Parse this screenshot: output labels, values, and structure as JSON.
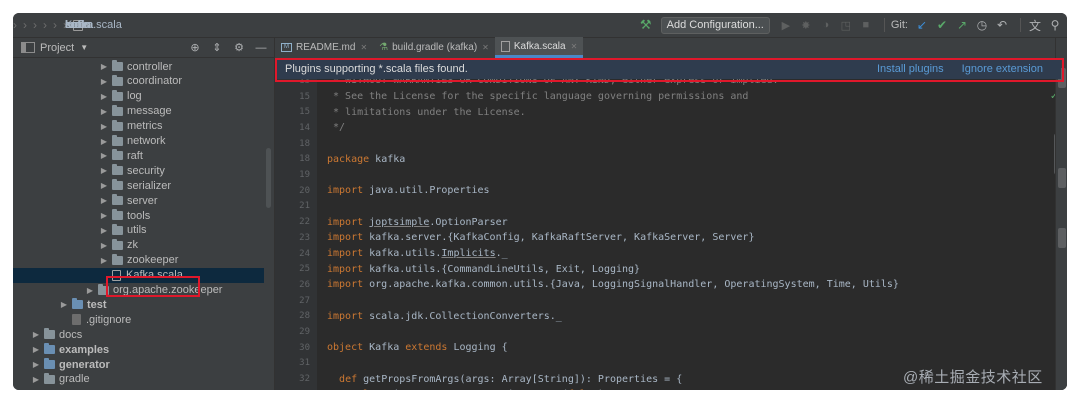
{
  "navbar": {
    "crumbs": [
      "kafka",
      "core",
      "src",
      "main",
      "scala",
      "kafka",
      "Kafka.scala"
    ],
    "add_configuration": "Add Configuration...",
    "git_label": "Git:"
  },
  "project_panel": {
    "title": "Project",
    "tree": [
      {
        "label": "controller",
        "type": "folder",
        "depth": 4
      },
      {
        "label": "coordinator",
        "type": "folder",
        "depth": 4
      },
      {
        "label": "log",
        "type": "folder",
        "depth": 4
      },
      {
        "label": "message",
        "type": "folder",
        "depth": 4
      },
      {
        "label": "metrics",
        "type": "folder",
        "depth": 4
      },
      {
        "label": "network",
        "type": "folder",
        "depth": 4
      },
      {
        "label": "raft",
        "type": "folder",
        "depth": 4
      },
      {
        "label": "security",
        "type": "folder",
        "depth": 4
      },
      {
        "label": "serializer",
        "type": "folder",
        "depth": 4
      },
      {
        "label": "server",
        "type": "folder",
        "depth": 4
      },
      {
        "label": "tools",
        "type": "folder",
        "depth": 4
      },
      {
        "label": "utils",
        "type": "folder",
        "depth": 4
      },
      {
        "label": "zk",
        "type": "folder",
        "depth": 4
      },
      {
        "label": "zookeeper",
        "type": "folder",
        "depth": 4
      },
      {
        "label": "Kafka.scala",
        "type": "scala",
        "depth": 4,
        "selected": true
      },
      {
        "label": "org.apache.zookeeper",
        "type": "folder",
        "depth": 3
      },
      {
        "label": "test",
        "type": "folder-blue",
        "depth": 2,
        "bold": true
      },
      {
        "label": ".gitignore",
        "type": "git",
        "depth": 2
      },
      {
        "label": "docs",
        "type": "folder",
        "depth": 1
      },
      {
        "label": "examples",
        "type": "folder-blue",
        "depth": 1,
        "bold": true
      },
      {
        "label": "generator",
        "type": "folder-blue",
        "depth": 1,
        "bold": true
      },
      {
        "label": "gradle",
        "type": "folder",
        "depth": 1
      }
    ]
  },
  "editor": {
    "tabs": [
      {
        "label": "README.md",
        "icon": "markdown-icon",
        "active": false
      },
      {
        "label": "build.gradle (kafka)",
        "icon": "gradle-icon",
        "active": false
      },
      {
        "label": "Kafka.scala",
        "icon": "scala-file-icon",
        "active": true
      }
    ],
    "banner": {
      "message": "Plugins supporting *.scala files found.",
      "install": "Install plugins",
      "ignore": "Ignore extension"
    },
    "lines": [
      {
        "n": "13",
        "t": " * WITHOUT WARRANTIES OR CONDITIONS OF ANY KIND, either express or implied.",
        "c": "comment"
      },
      {
        "n": "15",
        "t": " * See the License for the specific language governing permissions and",
        "c": "comment"
      },
      {
        "n": "15",
        "t": " * limitations under the License.",
        "c": "comment"
      },
      {
        "n": "14",
        "t": " */",
        "c": "comment"
      },
      {
        "n": "18",
        "t": "",
        "c": "plain"
      },
      {
        "n": "18",
        "t": "package kafka",
        "c": "plain"
      },
      {
        "n": "19",
        "t": "",
        "c": "plain"
      },
      {
        "n": "20",
        "t": "import java.util.Properties",
        "c": "plain"
      },
      {
        "n": "21",
        "t": "",
        "c": "plain"
      },
      {
        "n": "22",
        "t": "import joptsimple.OptionParser",
        "c": "plain"
      },
      {
        "n": "23",
        "t": "import kafka.server.{KafkaConfig, KafkaRaftServer, KafkaServer, Server}",
        "c": "plain"
      },
      {
        "n": "24",
        "t": "import kafka.utils.Implicits._",
        "c": "plain"
      },
      {
        "n": "25",
        "t": "import kafka.utils.{CommandLineUtils, Exit, Logging}",
        "c": "plain"
      },
      {
        "n": "26",
        "t": "import org.apache.kafka.common.utils.{Java, LoggingSignalHandler, OperatingSystem, Time, Utils}",
        "c": "plain"
      },
      {
        "n": "27",
        "t": "",
        "c": "plain"
      },
      {
        "n": "28",
        "t": "import scala.jdk.CollectionConverters._",
        "c": "plain"
      },
      {
        "n": "29",
        "t": "",
        "c": "plain"
      },
      {
        "n": "30",
        "t": "object Kafka extends Logging {",
        "c": "plain"
      },
      {
        "n": "31",
        "t": "",
        "c": "plain"
      },
      {
        "n": "32",
        "t": "  def getPropsFromArgs(args: Array[String]): Properties = {",
        "c": "plain"
      },
      {
        "n": "33",
        "t": "    val optionParser = new OptionParser(false)",
        "c": "plain"
      }
    ]
  },
  "watermark": "@稀土掘金技术社区",
  "colors": {
    "highlight": "#e0182b",
    "link": "#5a9bd6",
    "background": "#2b2b2b"
  }
}
